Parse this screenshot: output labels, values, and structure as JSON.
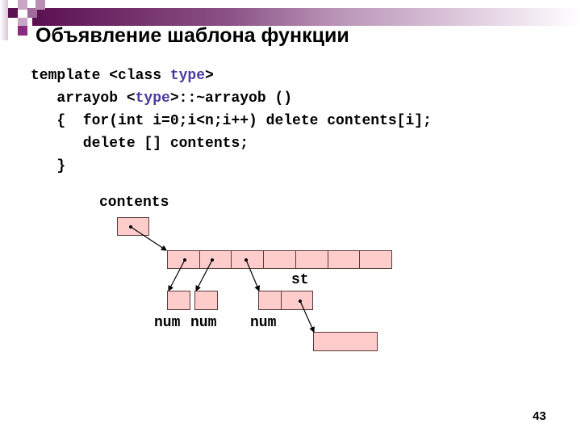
{
  "slide": {
    "title": "Объявление шаблона функции",
    "page_number": "43"
  },
  "code": {
    "line1_a": "template <class ",
    "line1_kw": "type",
    "line1_b": ">",
    "line2_a": "   arrayob <",
    "line2_kw": "type",
    "line2_b": ">::~arrayob ()",
    "line3": "   {  for(int i=0;i<n;i++) delete contents[i];",
    "line4": "      delete [] contents;",
    "line5": "   }"
  },
  "diagram": {
    "contents_label": "contents",
    "st_label": "st",
    "num_label_1": "num",
    "num_label_2": "num",
    "num_label_3": "num",
    "array_cells": 7
  },
  "colors": {
    "box_fill": "#ffcccc",
    "keyword": "#4b3aa0",
    "accent": "#5a1050"
  }
}
